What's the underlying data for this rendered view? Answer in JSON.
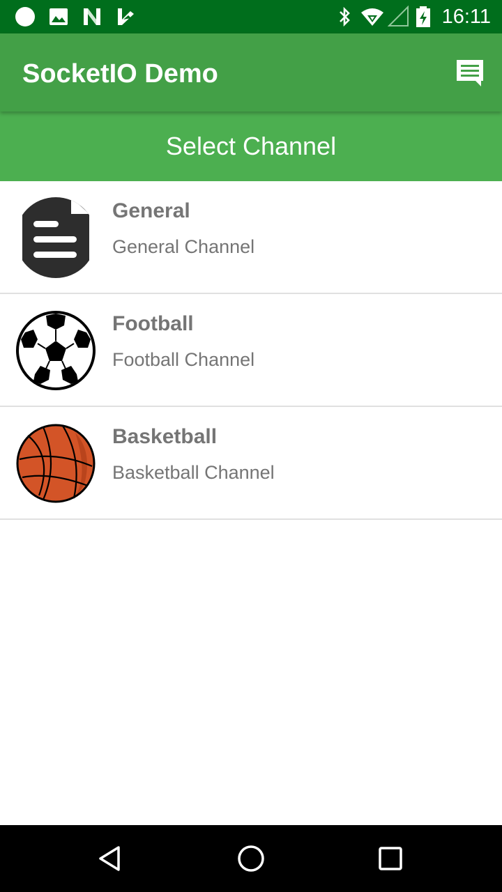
{
  "status_bar": {
    "time": "16:11",
    "left_icons": [
      "circle-notification-icon",
      "image-notification-icon",
      "n-logo-icon",
      "checkmark-app-icon"
    ],
    "right_icons": [
      "bluetooth-icon",
      "wifi-icon",
      "cell-signal-icon",
      "battery-icon"
    ]
  },
  "app_bar": {
    "title": "SocketIO Demo",
    "action_icon": "chat-icon"
  },
  "channel_header": {
    "label": "Select Channel"
  },
  "channels": [
    {
      "name": "General",
      "description": "General Channel",
      "icon": "document-icon"
    },
    {
      "name": "Football",
      "description": "Football Channel",
      "icon": "soccer-ball-icon"
    },
    {
      "name": "Basketball",
      "description": "Basketball Channel",
      "icon": "basketball-icon"
    }
  ],
  "nav_bar": {
    "buttons": [
      "back-icon",
      "home-icon",
      "recents-icon"
    ]
  },
  "colors": {
    "status_bar": "#006e1c",
    "app_bar": "#43a047",
    "channel_header": "#4caf50",
    "text_secondary": "#757575",
    "divider": "#e0e0e0"
  }
}
